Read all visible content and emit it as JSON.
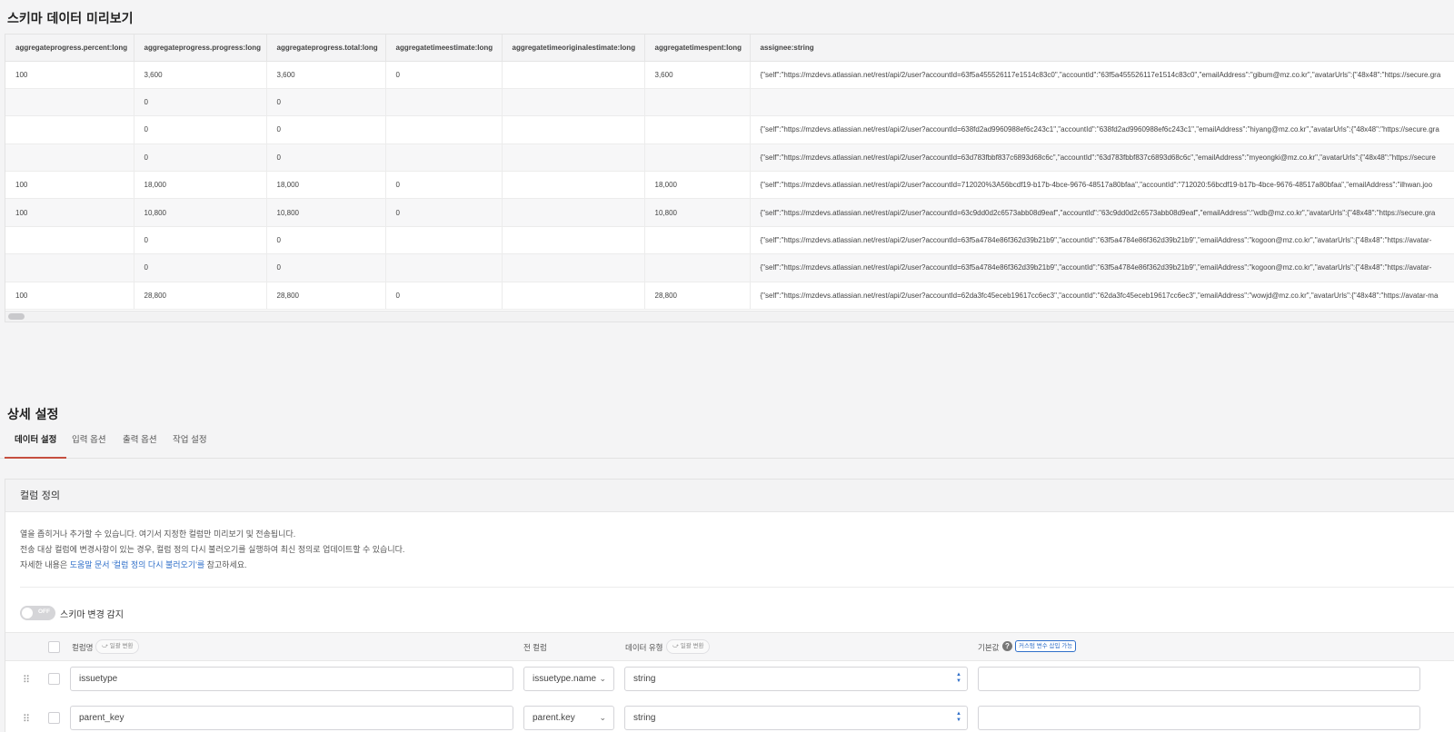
{
  "preview": {
    "title": "스키마 데이터 미리보기",
    "columns": [
      "aggregateprogress.percent:long",
      "aggregateprogress.progress:long",
      "aggregateprogress.total:long",
      "aggregatetimeestimate:long",
      "aggregatetimeoriginalestimate:long",
      "aggregatetimespent:long",
      "assignee:string"
    ],
    "rows": [
      [
        "100",
        "3,600",
        "3,600",
        "0",
        "",
        "3,600",
        "{\"self\":\"https://mzdevs.atlassian.net/rest/api/2/user?accountId=63f5a455526117e1514c83c0\",\"accountId\":\"63f5a455526117e1514c83c0\",\"emailAddress\":\"gibum@mz.co.kr\",\"avatarUrls\":{\"48x48\":\"https://secure.gra"
      ],
      [
        "",
        "0",
        "0",
        "",
        "",
        "",
        ""
      ],
      [
        "",
        "0",
        "0",
        "",
        "",
        "",
        "{\"self\":\"https://mzdevs.atlassian.net/rest/api/2/user?accountId=638fd2ad9960988ef6c243c1\",\"accountId\":\"638fd2ad9960988ef6c243c1\",\"emailAddress\":\"hiyang@mz.co.kr\",\"avatarUrls\":{\"48x48\":\"https://secure.gra"
      ],
      [
        "",
        "0",
        "0",
        "",
        "",
        "",
        "{\"self\":\"https://mzdevs.atlassian.net/rest/api/2/user?accountId=63d783fbbf837c6893d68c6c\",\"accountId\":\"63d783fbbf837c6893d68c6c\",\"emailAddress\":\"myeongki@mz.co.kr\",\"avatarUrls\":{\"48x48\":\"https://secure"
      ],
      [
        "100",
        "18,000",
        "18,000",
        "0",
        "",
        "18,000",
        "{\"self\":\"https://mzdevs.atlassian.net/rest/api/2/user?accountId=712020%3A56bcdf19-b17b-4bce-9676-48517a80bfaa\",\"accountId\":\"712020:56bcdf19-b17b-4bce-9676-48517a80bfaa\",\"emailAddress\":\"ilhwan.joo"
      ],
      [
        "100",
        "10,800",
        "10,800",
        "0",
        "",
        "10,800",
        "{\"self\":\"https://mzdevs.atlassian.net/rest/api/2/user?accountId=63c9dd0d2c6573abb08d9eaf\",\"accountId\":\"63c9dd0d2c6573abb08d9eaf\",\"emailAddress\":\"wdb@mz.co.kr\",\"avatarUrls\":{\"48x48\":\"https://secure.gra"
      ],
      [
        "",
        "0",
        "0",
        "",
        "",
        "",
        "{\"self\":\"https://mzdevs.atlassian.net/rest/api/2/user?accountId=63f5a4784e86f362d39b21b9\",\"accountId\":\"63f5a4784e86f362d39b21b9\",\"emailAddress\":\"kogoon@mz.co.kr\",\"avatarUrls\":{\"48x48\":\"https://avatar-"
      ],
      [
        "",
        "0",
        "0",
        "",
        "",
        "",
        "{\"self\":\"https://mzdevs.atlassian.net/rest/api/2/user?accountId=63f5a4784e86f362d39b21b9\",\"accountId\":\"63f5a4784e86f362d39b21b9\",\"emailAddress\":\"kogoon@mz.co.kr\",\"avatarUrls\":{\"48x48\":\"https://avatar-"
      ],
      [
        "100",
        "28,800",
        "28,800",
        "0",
        "",
        "28,800",
        "{\"self\":\"https://mzdevs.atlassian.net/rest/api/2/user?accountId=62da3fc45eceb19617cc6ec3\",\"accountId\":\"62da3fc45eceb19617cc6ec3\",\"emailAddress\":\"wowjd@mz.co.kr\",\"avatarUrls\":{\"48x48\":\"https://avatar-ma"
      ]
    ]
  },
  "detail": {
    "title": "상세 설정",
    "tabs": [
      "데이터 설정",
      "입력 옵션",
      "출력 옵션",
      "작업 설정"
    ],
    "active_tab": "데이터 설정"
  },
  "column_def": {
    "title": "컬럼 정의",
    "desc_line1": "열을 좁히거나 추가할 수 있습니다. 여기서 지정한 컬럼만 미리보기 및 전송됩니다.",
    "desc_line2": "전송 대상 컬럼에 변경사항이 있는 경우, 컬럼 정의 다시 불러오기를 실행하여 최신 정의로 업데이트할 수 있습니다.",
    "desc_line3_prefix": "자세한 내용은 ",
    "desc_line3_link": "도움말 문서 '컬럼 정의 다시 불러오기'를",
    "desc_line3_suffix": " 참고하세요.",
    "toggle_state": "OFF",
    "toggle_label": "스키마 변경 감지",
    "headers": {
      "column_name": "컬럼명",
      "column_name_pill": "⤻ 일괄 변환",
      "source_column": "전 컬럼",
      "data_type": "데이터 유형",
      "data_type_pill": "⤻ 일괄 변환",
      "default_value": "기본값",
      "default_badge": "커스텀 변수 삽입 가능"
    },
    "rows": [
      {
        "name": "issuetype",
        "source": "issuetype.name",
        "type": "string",
        "default": ""
      },
      {
        "name": "parent_key",
        "source": "parent.key",
        "type": "string",
        "default": ""
      }
    ]
  }
}
